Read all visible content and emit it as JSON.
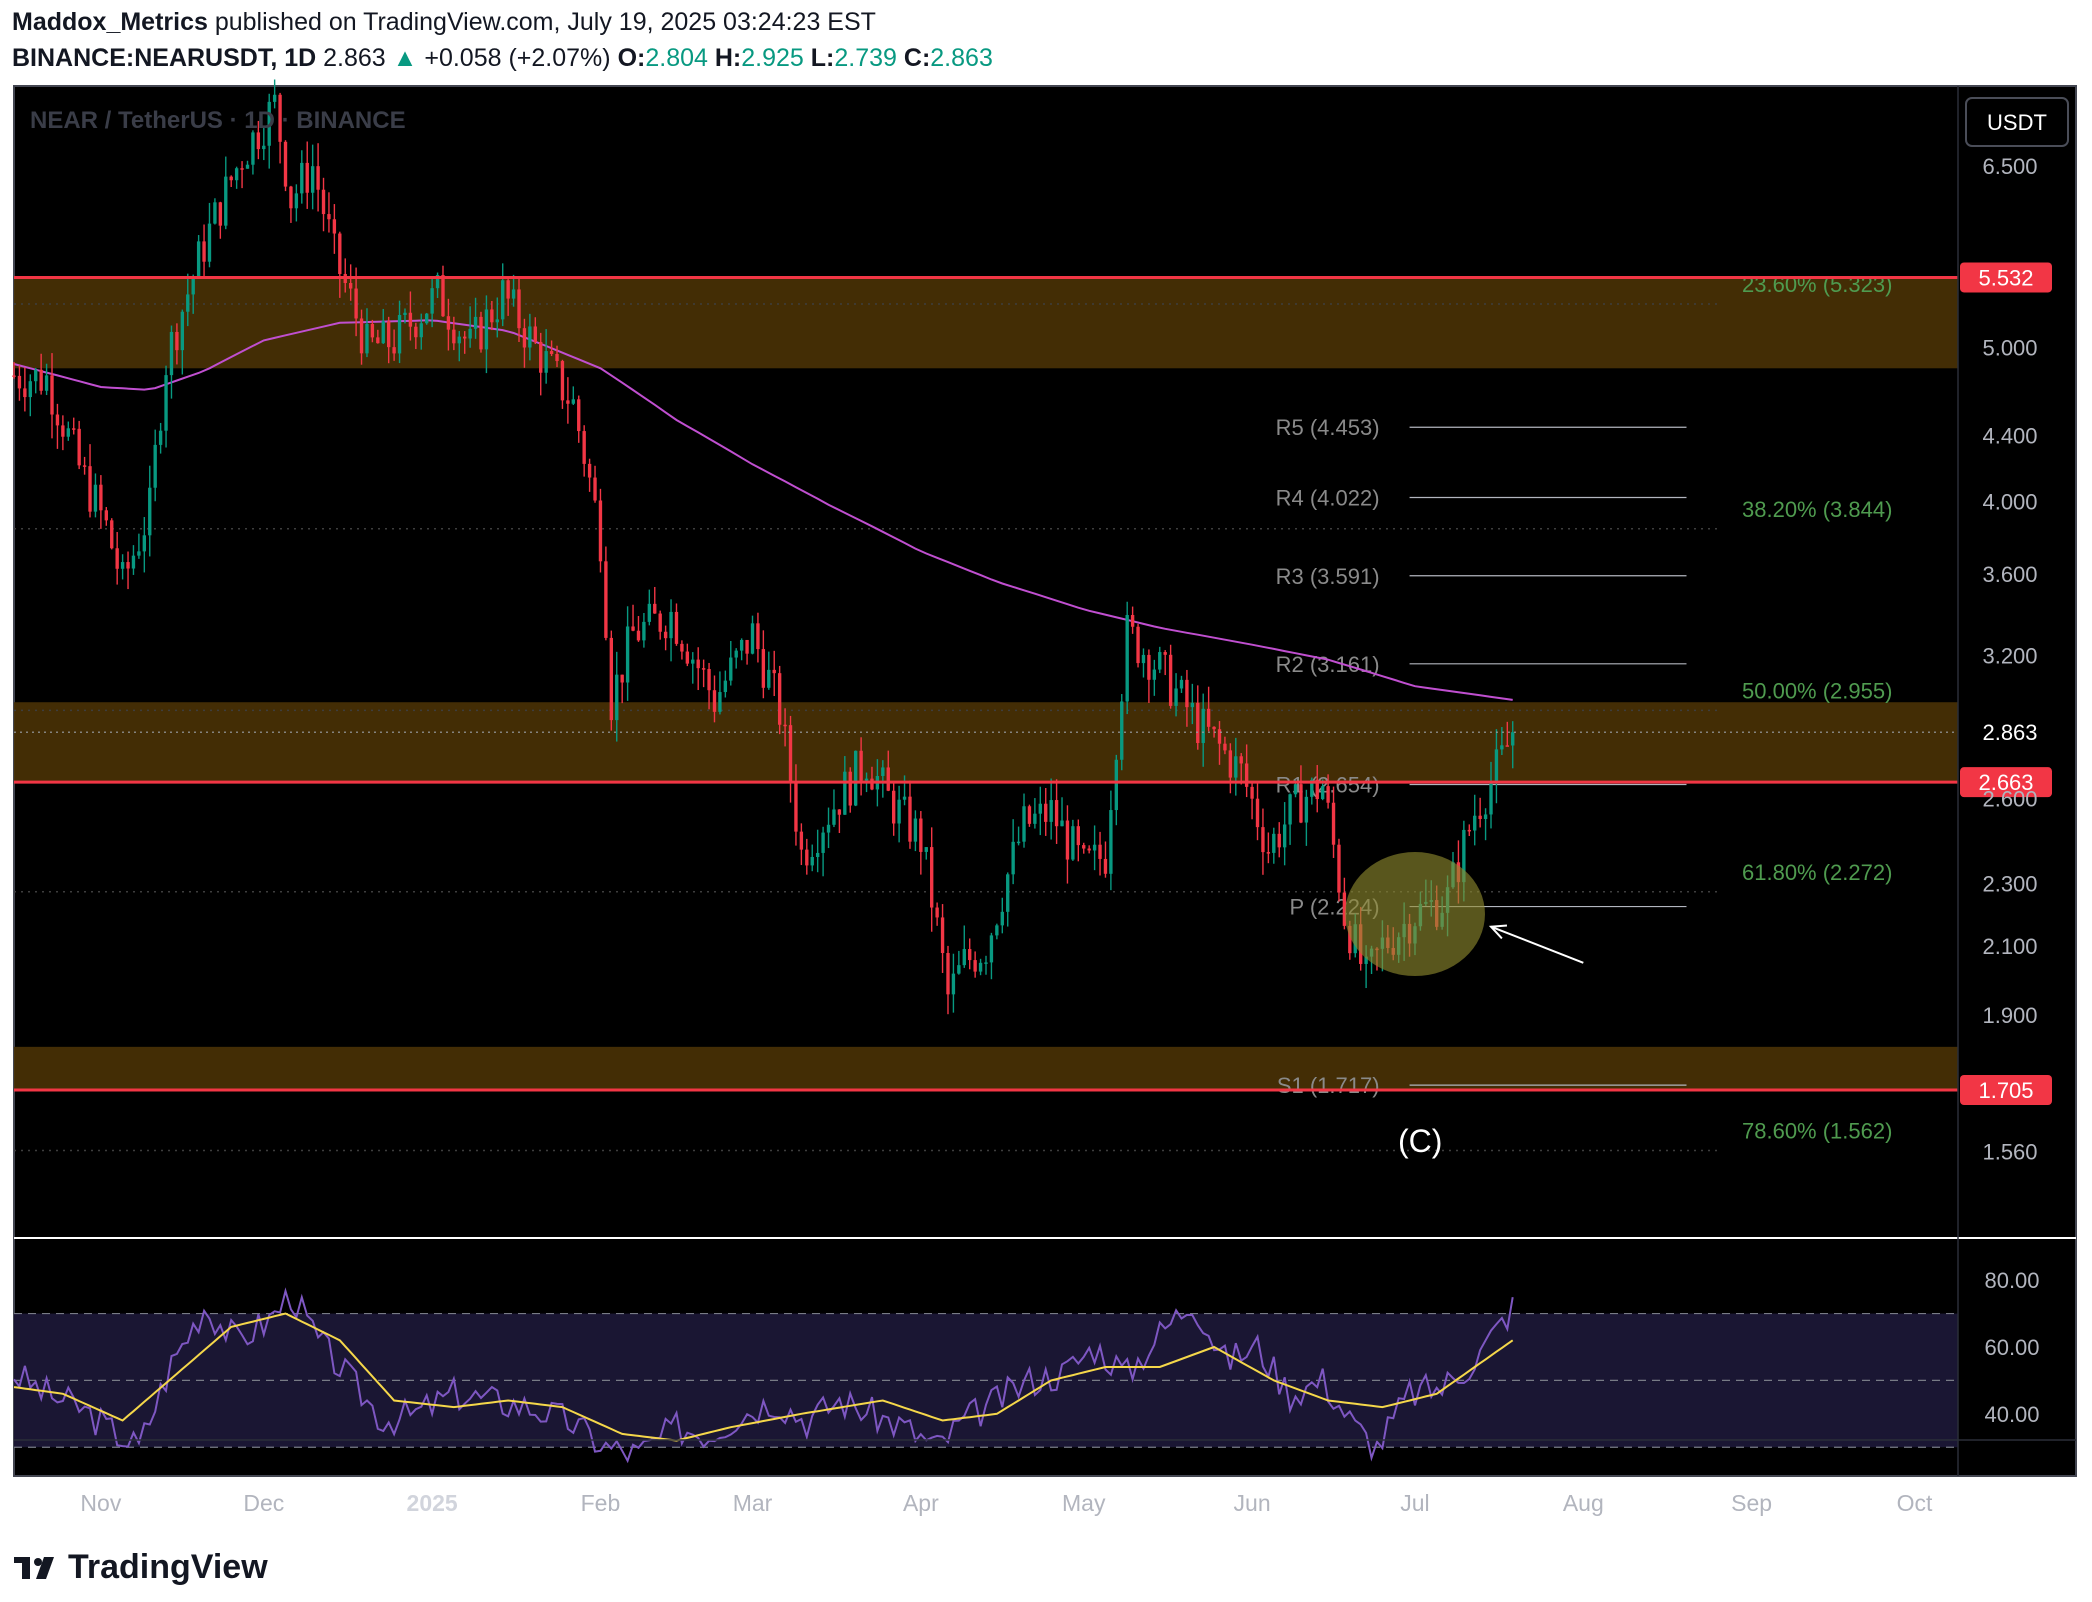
{
  "header": {
    "author": "Maddox_Metrics",
    "published_text": "published on TradingView.com, July 19, 2025 03:24:23 EST",
    "symbol": "BINANCE:NEARUSDT, 1D",
    "last": "2.863",
    "change_arrow": "▲",
    "change": "+0.058 (+2.07%)",
    "o_label": "O:",
    "o_value": "2.804",
    "h_label": "H:",
    "h_value": "2.925",
    "l_label": "L:",
    "l_value": "2.739",
    "c_label": "C:",
    "c_value": "2.863"
  },
  "watermark": "NEAR / TetherUS · 1D · BINANCE",
  "currency_button": "USDT",
  "annotation_c": "(C)",
  "footer": {
    "brand": "TradingView",
    "logo_icon": "tradingview-logo-icon"
  },
  "colors": {
    "up": "#089981",
    "down": "#f23645",
    "zone": "#4a3206",
    "level_line": "#f23645",
    "ema": "#c04fd0",
    "rsi": "#7e57c2",
    "rsi_ma": "#f5d74a",
    "fib": "#4f9b4f",
    "pivot": "#8a8a8a",
    "ellipse": "#8f8a2e"
  },
  "chart_data": [
    {
      "type": "candlestick",
      "symbol": "BINANCE:NEARUSDT",
      "timeframe": "1D",
      "y_scale": "log",
      "ylim": [
        1.38,
        7.3
      ],
      "y_ticks": [
        "6.500",
        "5.000",
        "4.400",
        "4.000",
        "3.600",
        "3.200",
        "2.600",
        "2.300",
        "2.100",
        "1.900",
        "1.560"
      ],
      "x_ticks": [
        "Nov",
        "Dec",
        "2025",
        "Feb",
        "Mar",
        "Apr",
        "May",
        "Jun",
        "Jul",
        "Aug",
        "Sep",
        "Oct"
      ],
      "x_range": [
        "2024-10-16",
        "2025-10-09"
      ],
      "last_price": {
        "label": "2.863",
        "value": 2.863
      },
      "price_levels": [
        {
          "label": "5.532",
          "value": 5.532
        },
        {
          "label": "2.663",
          "value": 2.663
        },
        {
          "label": "1.705",
          "value": 1.705
        }
      ],
      "zones": [
        {
          "from": 4.85,
          "to": 5.532
        },
        {
          "from": 2.663,
          "to": 2.99
        },
        {
          "from": 1.705,
          "to": 1.815
        }
      ],
      "fib_levels": [
        {
          "label": "23.60% (5.323)",
          "value": 5.323
        },
        {
          "label": "38.20% (3.844)",
          "value": 3.844
        },
        {
          "label": "50.00% (2.955)",
          "value": 2.955
        },
        {
          "label": "61.80% (2.272)",
          "value": 2.272
        },
        {
          "label": "78.60% (1.562)",
          "value": 1.562
        }
      ],
      "pivots": [
        {
          "label": "R5 (4.453)",
          "value": 4.453
        },
        {
          "label": "R4 (4.022)",
          "value": 4.022
        },
        {
          "label": "R3 (3.591)",
          "value": 3.591
        },
        {
          "label": "R2 (3.161)",
          "value": 3.161
        },
        {
          "label": "R1 (2.654)",
          "value": 2.654
        },
        {
          "label": "P (2.224)",
          "value": 2.224
        },
        {
          "label": "S1 (1.717)",
          "value": 1.717
        }
      ],
      "pivot_range": [
        "2025-06-30",
        "2025-08-20"
      ],
      "ema": {
        "dates": [
          "2024-10-16",
          "2024-11-01",
          "2024-11-10",
          "2024-11-20",
          "2024-12-01",
          "2024-12-15",
          "2025-01-01",
          "2025-01-15",
          "2025-02-01",
          "2025-02-15",
          "2025-03-01",
          "2025-03-15",
          "2025-04-01",
          "2025-04-15",
          "2025-05-01",
          "2025-05-15",
          "2025-06-01",
          "2025-06-15",
          "2025-07-01",
          "2025-07-19"
        ],
        "values": [
          4.88,
          4.72,
          4.7,
          4.83,
          5.05,
          5.18,
          5.2,
          5.12,
          4.85,
          4.5,
          4.22,
          3.98,
          3.72,
          3.56,
          3.42,
          3.33,
          3.25,
          3.18,
          3.06,
          3.0
        ]
      },
      "ohlc_anchors": {
        "dates": [
          "2024-10-16",
          "2024-10-22",
          "2024-10-28",
          "2024-11-02",
          "2024-11-05",
          "2024-11-10",
          "2024-11-13",
          "2024-11-20",
          "2024-11-27",
          "2024-12-03",
          "2024-12-06",
          "2024-12-10",
          "2024-12-14",
          "2024-12-20",
          "2024-12-25",
          "2025-01-02",
          "2025-01-08",
          "2025-01-14",
          "2025-01-20",
          "2025-01-27",
          "2025-02-01",
          "2025-02-03",
          "2025-02-07",
          "2025-02-14",
          "2025-02-22",
          "2025-03-01",
          "2025-03-06",
          "2025-03-10",
          "2025-03-15",
          "2025-03-22",
          "2025-03-26",
          "2025-04-01",
          "2025-04-06",
          "2025-04-09",
          "2025-04-13",
          "2025-04-20",
          "2025-04-25",
          "2025-05-01",
          "2025-05-05",
          "2025-05-09",
          "2025-05-13",
          "2025-05-22",
          "2025-05-30",
          "2025-06-04",
          "2025-06-10",
          "2025-06-14",
          "2025-06-18",
          "2025-06-22",
          "2025-06-25",
          "2025-07-01",
          "2025-07-07",
          "2025-07-12",
          "2025-07-17",
          "2025-07-19"
        ],
        "values": [
          4.8,
          4.78,
          4.2,
          3.85,
          3.55,
          3.95,
          4.9,
          5.8,
          6.6,
          7.1,
          6.2,
          6.5,
          5.7,
          5.0,
          5.05,
          5.4,
          5.0,
          5.4,
          5.0,
          4.6,
          3.8,
          3.0,
          3.3,
          3.4,
          3.0,
          3.3,
          2.95,
          2.4,
          2.55,
          2.75,
          2.6,
          2.45,
          1.95,
          2.05,
          2.1,
          2.5,
          2.55,
          2.35,
          2.4,
          3.3,
          3.2,
          2.9,
          2.7,
          2.42,
          2.6,
          2.65,
          2.2,
          2.0,
          2.1,
          2.2,
          2.25,
          2.55,
          2.75,
          2.863
        ]
      },
      "annotations": [
        {
          "type": "ellipse",
          "center_date": "2025-07-01",
          "center_value": 2.2
        },
        {
          "type": "arrow",
          "from_date": "2025-08-01",
          "from_value": 2.05,
          "to_date": "2025-07-15",
          "to_value": 2.16
        },
        {
          "type": "label",
          "text": "(C)",
          "date": "2025-06-22",
          "value": 1.67
        }
      ]
    },
    {
      "type": "line",
      "name": "RSI",
      "ylim": [
        22,
        92
      ],
      "y_ticks": [
        "80.00",
        "60.00",
        "40.00"
      ],
      "bands": [
        30,
        50,
        70
      ],
      "rsi": {
        "dates": [
          "2024-10-16",
          "2024-10-22",
          "2024-10-28",
          "2024-11-03",
          "2024-11-08",
          "2024-11-14",
          "2024-11-20",
          "2024-11-26",
          "2024-12-02",
          "2024-12-06",
          "2024-12-11",
          "2024-12-17",
          "2024-12-23",
          "2024-12-29",
          "2025-01-05",
          "2025-01-12",
          "2025-01-19",
          "2025-01-26",
          "2025-02-02",
          "2025-02-08",
          "2025-02-15",
          "2025-02-21",
          "2025-02-27",
          "2025-03-05",
          "2025-03-11",
          "2025-03-17",
          "2025-03-23",
          "2025-03-29",
          "2025-04-04",
          "2025-04-09",
          "2025-04-15",
          "2025-04-21",
          "2025-04-27",
          "2025-05-03",
          "2025-05-09",
          "2025-05-15",
          "2025-05-21",
          "2025-05-27",
          "2025-06-02",
          "2025-06-08",
          "2025-06-14",
          "2025-06-20",
          "2025-06-24",
          "2025-06-30",
          "2025-07-06",
          "2025-07-12",
          "2025-07-19"
        ],
        "values": [
          52,
          46,
          42,
          35,
          30,
          55,
          72,
          62,
          68,
          76,
          62,
          50,
          38,
          40,
          46,
          44,
          42,
          38,
          30,
          28,
          36,
          34,
          40,
          44,
          38,
          44,
          40,
          36,
          30,
          38,
          44,
          50,
          52,
          60,
          52,
          64,
          74,
          56,
          60,
          46,
          50,
          36,
          30,
          46,
          48,
          56,
          72
        ]
      },
      "rsi_ma": {
        "dates": [
          "2024-10-16",
          "2024-10-25",
          "2024-11-05",
          "2024-11-15",
          "2024-11-25",
          "2024-12-05",
          "2024-12-15",
          "2024-12-25",
          "2025-01-05",
          "2025-01-15",
          "2025-01-25",
          "2025-02-05",
          "2025-02-15",
          "2025-02-25",
          "2025-03-10",
          "2025-03-25",
          "2025-04-05",
          "2025-04-15",
          "2025-04-25",
          "2025-05-05",
          "2025-05-15",
          "2025-05-25",
          "2025-06-05",
          "2025-06-15",
          "2025-06-25",
          "2025-07-05",
          "2025-07-19"
        ],
        "values": [
          48,
          46,
          38,
          52,
          66,
          70,
          62,
          44,
          42,
          44,
          42,
          34,
          32,
          36,
          40,
          44,
          38,
          40,
          50,
          54,
          54,
          60,
          50,
          44,
          42,
          46,
          62
        ]
      }
    }
  ]
}
